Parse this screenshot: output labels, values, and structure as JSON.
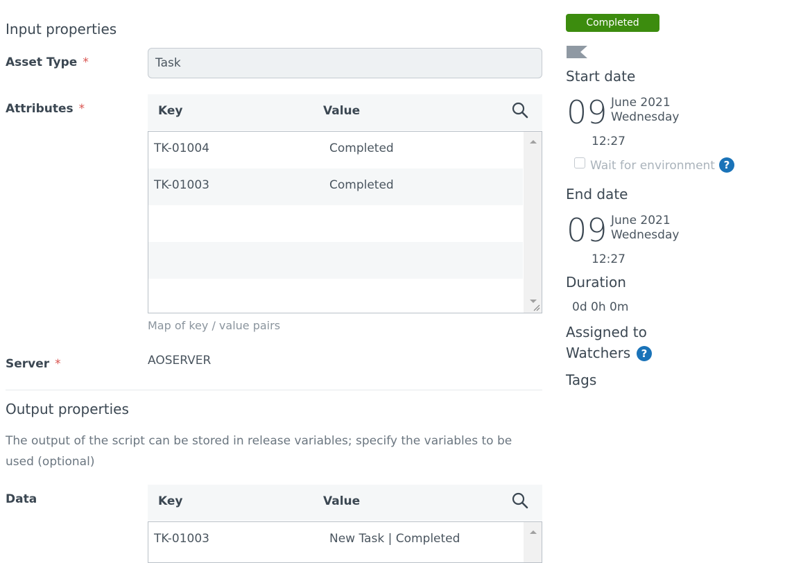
{
  "input": {
    "title": "Input properties",
    "asset_type_label": "Asset Type",
    "asset_type_value": "Task",
    "attributes_label": "Attributes",
    "required_mark": "*",
    "key_header": "Key",
    "value_header": "Value",
    "rows": [
      {
        "key": "TK-01004",
        "value": "Completed"
      },
      {
        "key": "TK-01003",
        "value": "Completed"
      }
    ],
    "map_help": "Map of key / value pairs",
    "server_label": "Server",
    "server_value": "AOSERVER"
  },
  "output": {
    "title": "Output properties",
    "description": "The output of the script can be stored in release variables; specify the variables to be used (optional)",
    "data_label": "Data",
    "key_header": "Key",
    "value_header": "Value",
    "rows": [
      {
        "key": "TK-01003",
        "value": "New Task | Completed"
      }
    ]
  },
  "side": {
    "status": "Completed",
    "status_color": "#3c8c0e",
    "start_title": "Start date",
    "start_day": "09",
    "start_month": "June 2021",
    "start_weekday": "Wednesday",
    "start_time": "12:27",
    "wait_label": "Wait for environment",
    "end_title": "End date",
    "end_day": "09",
    "end_month": "June 2021",
    "end_weekday": "Wednesday",
    "end_time": "12:27",
    "duration_title": "Duration",
    "duration_value": "0d 0h 0m",
    "assigned_title": "Assigned to",
    "watchers_title": "Watchers",
    "tags_title": "Tags",
    "help_glyph": "?"
  }
}
